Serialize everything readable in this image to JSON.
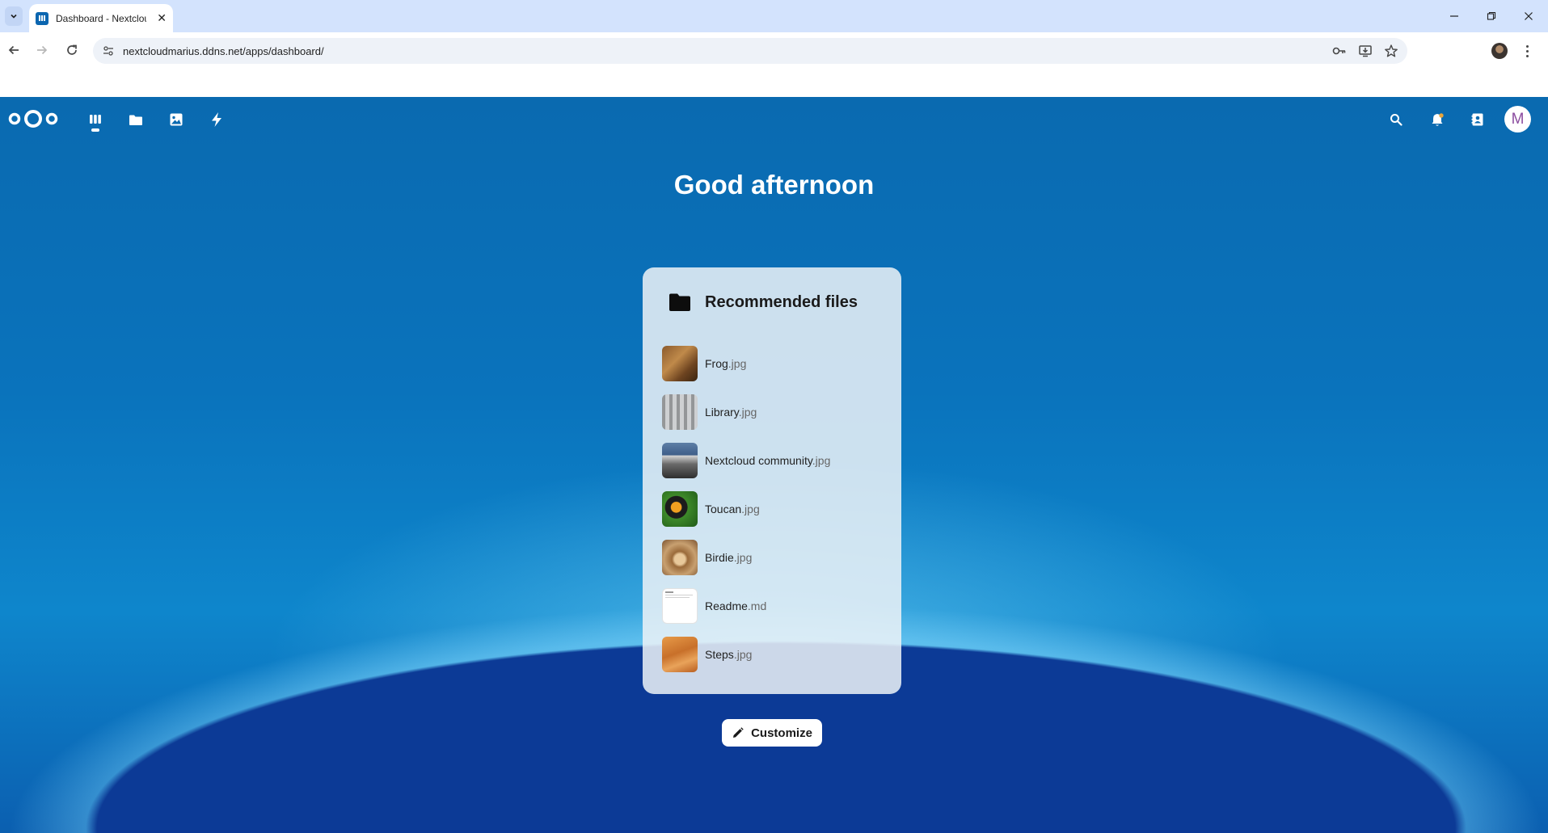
{
  "browser": {
    "tab_title": "Dashboard - Nextcloud",
    "tab_close": "✕",
    "url": "nextcloudmarius.ddns.net/apps/dashboard/",
    "window_minimize": "—",
    "window_restore": "❐",
    "window_close": "✕"
  },
  "nextcloud": {
    "avatar_initial": "M",
    "greeting": "Good afternoon",
    "widget": {
      "title": "Recommended files",
      "files": [
        {
          "name": "Frog",
          "ext": ".jpg"
        },
        {
          "name": "Library",
          "ext": ".jpg"
        },
        {
          "name": "Nextcloud community",
          "ext": ".jpg"
        },
        {
          "name": "Toucan",
          "ext": ".jpg"
        },
        {
          "name": "Birdie",
          "ext": ".jpg"
        },
        {
          "name": "Readme",
          "ext": ".md"
        },
        {
          "name": "Steps",
          "ext": ".jpg"
        }
      ]
    },
    "customize_label": "Customize"
  },
  "colors": {
    "header_blue": "#0a6ab0",
    "avatar_text": "#8c4ea0",
    "panel_bg": "#ecf2f7"
  }
}
